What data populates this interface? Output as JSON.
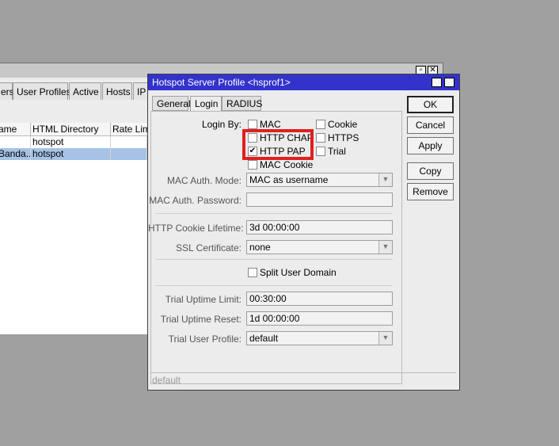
{
  "background_window": {
    "tabs": [
      "ers",
      "User Profiles",
      "Active",
      "Hosts",
      "IP"
    ],
    "columns": [
      "ame",
      "HTML Directory",
      "Rate Limi"
    ],
    "rows": [
      {
        "name": "",
        "html_directory": "hotspot",
        "rate_limit": "",
        "selected": false
      },
      {
        "name": "Banda...",
        "html_directory": "hotspot",
        "rate_limit": "",
        "selected": true
      }
    ]
  },
  "dialog": {
    "title": "Hotspot Server Profile <hsprof1>",
    "tabs": [
      "General",
      "Login",
      "RADIUS"
    ],
    "active_tab": "Login",
    "login_by": {
      "label": "Login By:",
      "options": [
        {
          "label": "MAC",
          "checked": false
        },
        {
          "label": "Cookie",
          "checked": false
        },
        {
          "label": "HTTP CHAP",
          "checked": false
        },
        {
          "label": "HTTPS",
          "checked": false
        },
        {
          "label": "HTTP PAP",
          "checked": true
        },
        {
          "label": "Trial",
          "checked": false
        },
        {
          "label": "MAC Cookie",
          "checked": false
        }
      ]
    },
    "fields": {
      "mac_auth_mode": {
        "label": "MAC Auth. Mode:",
        "value": "MAC as username"
      },
      "mac_auth_password": {
        "label": "MAC Auth. Password:",
        "value": ""
      },
      "http_cookie_lifetime": {
        "label": "HTTP Cookie Lifetime:",
        "value": "3d 00:00:00"
      },
      "ssl_certificate": {
        "label": "SSL Certificate:",
        "value": "none"
      },
      "split_user_domain": {
        "label": "Split User Domain",
        "checked": false
      },
      "trial_uptime_limit": {
        "label": "Trial Uptime Limit:",
        "value": "00:30:00"
      },
      "trial_uptime_reset": {
        "label": "Trial Uptime Reset:",
        "value": "1d 00:00:00"
      },
      "trial_user_profile": {
        "label": "Trial User Profile:",
        "value": "default"
      }
    },
    "buttons": {
      "ok": "OK",
      "cancel": "Cancel",
      "apply": "Apply",
      "copy": "Copy",
      "remove": "Remove"
    },
    "status": "default"
  },
  "colors": {
    "title_bar": "#3333cc",
    "highlight": "#e02020",
    "selected_row": "#a6c3e6"
  }
}
